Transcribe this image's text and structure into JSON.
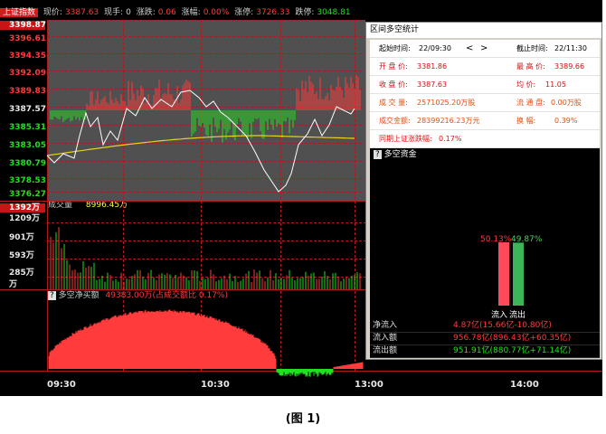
{
  "header": {
    "title": "上证指数",
    "items": [
      {
        "label": "现价:",
        "value": "3387.63",
        "color": "#ff3b3b"
      },
      {
        "label": "现手:",
        "value": "0",
        "color": "#cfcfcf"
      },
      {
        "label": "涨跌:",
        "value": "0.06",
        "color": "#ff3b3b"
      },
      {
        "label": "涨幅:",
        "value": "0.00%",
        "color": "#ff3b3b"
      },
      {
        "label": "涨停:",
        "value": "3726.33",
        "color": "#ff3b3b"
      },
      {
        "label": "跌停:",
        "value": "3048.81",
        "color": "#20e020"
      }
    ]
  },
  "price_axis": [
    "3398.87",
    "3396.61",
    "3394.35",
    "3392.09",
    "3389.83",
    "3387.57",
    "3385.31",
    "3383.05",
    "3380.79",
    "3378.53",
    "3376.27"
  ],
  "volume_panel": {
    "title": "成交量",
    "value": "8996.45万",
    "axis": [
      "1392万",
      "1209万",
      "901万",
      "593万",
      "285万",
      "万"
    ]
  },
  "money_panel": {
    "icon": "?",
    "title": "多空净买额",
    "value": "49383.00万(占成交额比 0.17%)"
  },
  "time_axis": [
    "09:30",
    "10:30",
    "13:00",
    "14:00"
  ],
  "popup": {
    "title": "区间多空统计",
    "start_label": "起始时间:",
    "start_value": "22/09:30",
    "prev_arrow": "<",
    "next_arrow": ">",
    "end_label": "截止时间:",
    "end_value": "22/11:30",
    "open_label": "开 盘 价:",
    "open_value": "3381.86",
    "high_label": "最 高 价:",
    "high_value": "3389.66",
    "close_label": "收 盘 价:",
    "close_value": "3387.63",
    "avg_label": "均  价:",
    "avg_value": "11.05",
    "vol_label": "成 交 量:",
    "vol_value": "2571025.20万股",
    "float_label": "流 通 盘:",
    "float_value": "0.00万股",
    "amount_label": "成交金额:",
    "amount_value": "28399216.23万元",
    "turnover_label": "换  幅:",
    "turnover_value": "0.39%",
    "compare_label": "同期上证涨跌幅:",
    "compare_value": "0.17%",
    "flow_icon": "?",
    "flow_title": "多空资金",
    "inflow_pct": 50.13,
    "outflow_pct": 49.87,
    "inflow_pct_label": "50.13%",
    "outflow_pct_label": "49.87%",
    "inflow_label": "流入",
    "outflow_label": "流出",
    "net_label": "净流入",
    "net_value": "4.87亿(15.66亿-10.80亿)",
    "in_label": "流入额",
    "in_value": "956.78亿(896.43亿+60.35亿)",
    "out_label": "流出额",
    "out_value": "951.91亿(880.77亿+71.14亿)"
  },
  "caption": "(图 1)",
  "colors": {
    "up": "#ff3b3b",
    "down": "#20e020",
    "avg_line": "#e6d21e",
    "price_line": "#ffffff",
    "grid": "#b01a1a"
  }
}
